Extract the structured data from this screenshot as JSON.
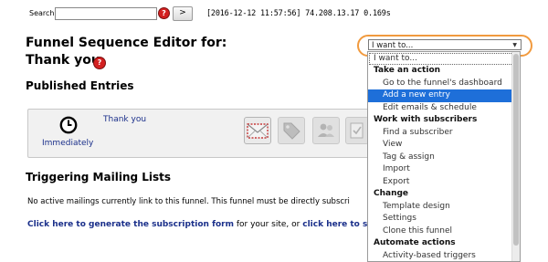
{
  "search": {
    "label": "Search:",
    "value": "",
    "go_label": ">",
    "help_icon": "?"
  },
  "server_info": "[2016-12-12 11:57:56] 74.208.13.17 0.169s",
  "page": {
    "title_line1": "Funnel Sequence Editor for:",
    "title_line2": "Thank you",
    "help_icon": "?"
  },
  "published": {
    "heading": "Published Entries",
    "entry": {
      "name": "Thank you",
      "timing": "Immediately",
      "icons": [
        "clock-icon",
        "email-icon",
        "tag-icon",
        "subscribers-icon",
        "report-icon"
      ]
    }
  },
  "triggering": {
    "heading": "Triggering Mailing Lists",
    "no_active_text": "No active mailings currently link to this funnel. This funnel must be directly subscri",
    "generate_link": "Click here to generate the subscription form",
    "middle_text": " for your site, or ",
    "see_all_link": "click here to see al"
  },
  "select": {
    "value": "I want to...",
    "arrow_glyph": "▼",
    "accent": "#f19a3e",
    "options": [
      {
        "label": "I want to...",
        "kind": "first"
      },
      {
        "label": "Take an action",
        "kind": "group"
      },
      {
        "label": "Go to the funnel's dashboard",
        "kind": "item"
      },
      {
        "label": "Add a new entry",
        "kind": "selected"
      },
      {
        "label": "Edit emails & schedule",
        "kind": "item"
      },
      {
        "label": "Work with subscribers",
        "kind": "group"
      },
      {
        "label": "Find a subscriber",
        "kind": "item"
      },
      {
        "label": "View",
        "kind": "item"
      },
      {
        "label": "Tag & assign",
        "kind": "item"
      },
      {
        "label": "Import",
        "kind": "item"
      },
      {
        "label": "Export",
        "kind": "item"
      },
      {
        "label": "Change",
        "kind": "group"
      },
      {
        "label": "Template design",
        "kind": "item"
      },
      {
        "label": "Settings",
        "kind": "item"
      },
      {
        "label": "Clone this funnel",
        "kind": "item"
      },
      {
        "label": "Automate actions",
        "kind": "group"
      },
      {
        "label": "Activity-based triggers",
        "kind": "item"
      }
    ],
    "highlight_color": "#1e6fd9"
  }
}
